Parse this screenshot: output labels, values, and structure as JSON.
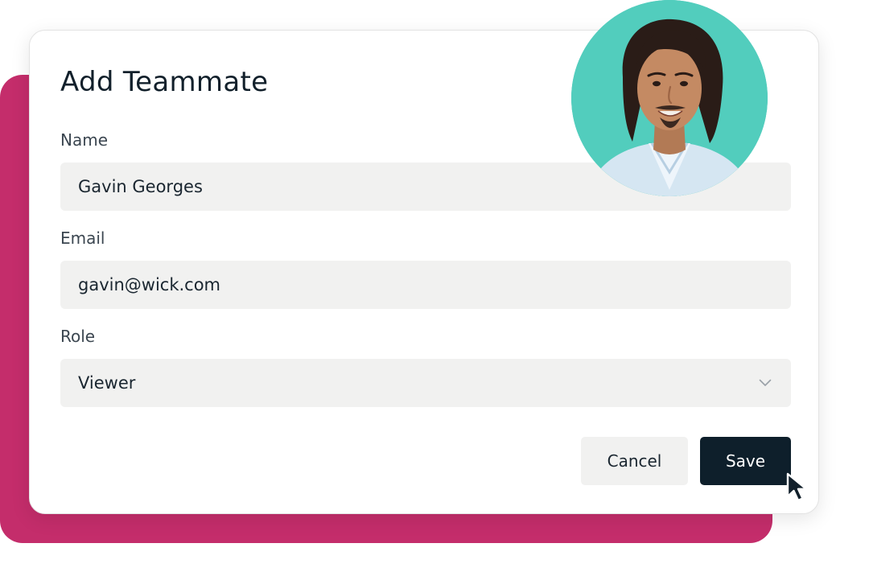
{
  "dialog": {
    "title": "Add Teammate",
    "name_label": "Name",
    "name_value": "Gavin Georges",
    "email_label": "Email",
    "email_value": "gavin@wick.com",
    "role_label": "Role",
    "role_value": "Viewer",
    "cancel_label": "Cancel",
    "save_label": "Save"
  },
  "colors": {
    "backdrop": "#c42d6b",
    "primary_button": "#0e1f2b",
    "field_background": "#f1f1f0",
    "avatar_background": "#52cdbd"
  },
  "icons": {
    "role_dropdown": "chevron-down-icon",
    "pointer": "cursor-arrow-icon"
  }
}
